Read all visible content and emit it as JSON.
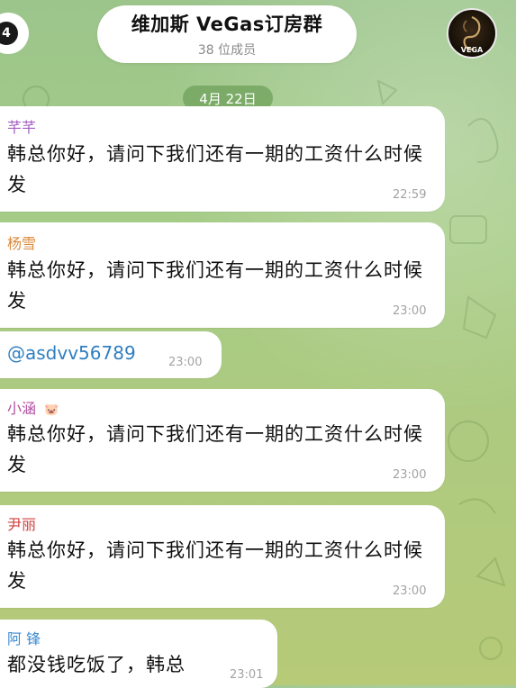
{
  "header": {
    "back_count": "4",
    "title": "维加斯 VeGas订房群",
    "subtitle": "38 位成员",
    "avatar_text": "VEGA"
  },
  "date_label": "4月 22日",
  "messages": [
    {
      "sender": "芊芊",
      "sender_color": "#a35fc1",
      "text": "韩总你好，请问下我们还有一期的工资什么时候发",
      "time": "22:59"
    },
    {
      "sender": "杨雪",
      "sender_color": "#d98a3c",
      "text": "韩总你好，请问下我们还有一期的工资什么时候发",
      "time": "23:00"
    },
    {
      "mention": "@asdvv56789",
      "time": "23:00"
    },
    {
      "sender": "小涵",
      "sender_color": "#b24ea1",
      "sender_emoji": "🐷",
      "text": "韩总你好，请问下我们还有一期的工资什么时候发",
      "time": "23:00"
    },
    {
      "sender": "尹丽",
      "sender_color": "#d0433f",
      "text": "韩总你好，请问下我们还有一期的工资什么时候发",
      "time": "23:00"
    },
    {
      "sender": "阿 锋",
      "sender_color": "#3d8ad0",
      "text": "都没钱吃饭了，韩总",
      "time": "23:01"
    }
  ]
}
